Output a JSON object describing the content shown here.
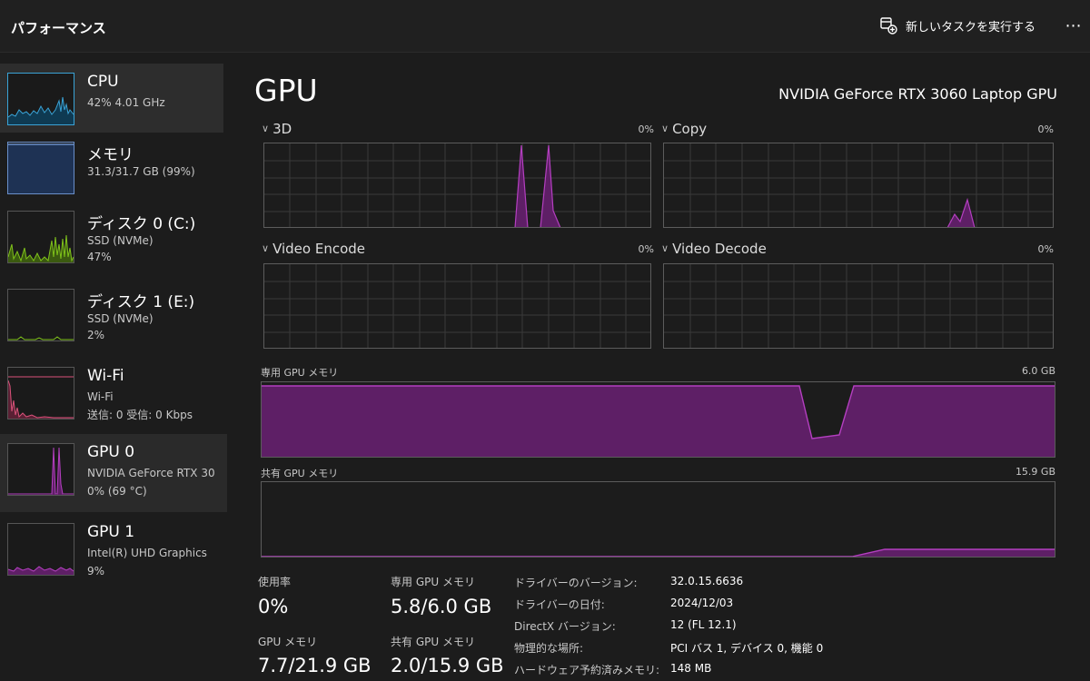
{
  "header": {
    "title": "パフォーマンス",
    "new_task_label": "新しいタスクを実行する",
    "more_label": "⋯"
  },
  "sidebar": {
    "items": [
      {
        "name": "CPU",
        "sub1": "42%  4.01 GHz",
        "sub2": "",
        "color": "#3aa3d6"
      },
      {
        "name": "メモリ",
        "sub1": "31.3/31.7 GB (99%)",
        "sub2": "",
        "color": "#6a8fc9"
      },
      {
        "name": "ディスク 0 (C:)",
        "sub1": "SSD (NVMe)",
        "sub2": "47%",
        "color": "#7fc21a"
      },
      {
        "name": "ディスク 1 (E:)",
        "sub1": "SSD (NVMe)",
        "sub2": "2%",
        "color": "#7fc21a"
      },
      {
        "name": "Wi-Fi",
        "sub1": "Wi-Fi",
        "sub2": "送信: 0  受信: 0 Kbps",
        "color": "#d9527a"
      },
      {
        "name": "GPU 0",
        "sub1": "NVIDIA GeForce RTX 30",
        "sub2": "0% (69 °C)",
        "color": "#b43fc0"
      },
      {
        "name": "GPU 1",
        "sub1": "Intel(R) UHD Graphics",
        "sub2": "9%",
        "color": "#b43fc0"
      }
    ]
  },
  "main": {
    "heading": "GPU",
    "model": "NVIDIA GeForce RTX 3060 Laptop GPU",
    "engines": [
      {
        "label": "3D",
        "pct": "0%"
      },
      {
        "label": "Copy",
        "pct": "0%"
      },
      {
        "label": "Video Encode",
        "pct": "0%"
      },
      {
        "label": "Video Decode",
        "pct": "0%"
      }
    ],
    "dedicated_label": "専用 GPU メモリ",
    "dedicated_max": "6.0 GB",
    "shared_label": "共有 GPU メモリ",
    "shared_max": "15.9 GB",
    "stats": {
      "usage_label": "使用率",
      "usage_value": "0%",
      "gpu_mem_label": "GPU メモリ",
      "gpu_mem_value": "7.7/21.9 GB",
      "dedicated_label": "専用 GPU メモリ",
      "dedicated_value": "5.8/6.0 GB",
      "shared_label": "共有 GPU メモリ",
      "shared_value": "2.0/15.9 GB"
    },
    "info": [
      {
        "key": "ドライバーのバージョン:",
        "value": "32.0.15.6636"
      },
      {
        "key": "ドライバーの日付:",
        "value": "2024/12/03"
      },
      {
        "key": "DirectX バージョン:",
        "value": "12 (FL 12.1)"
      },
      {
        "key": "物理的な場所:",
        "value": "PCI バス 1, デバイス 0, 機能 0"
      },
      {
        "key": "ハードウェア予約済みメモリ:",
        "value": "148 MB"
      }
    ]
  },
  "colors": {
    "gpu_line": "#b43fc0",
    "gpu_fill": "#5e1f66",
    "grid": "#3a3a3a"
  }
}
